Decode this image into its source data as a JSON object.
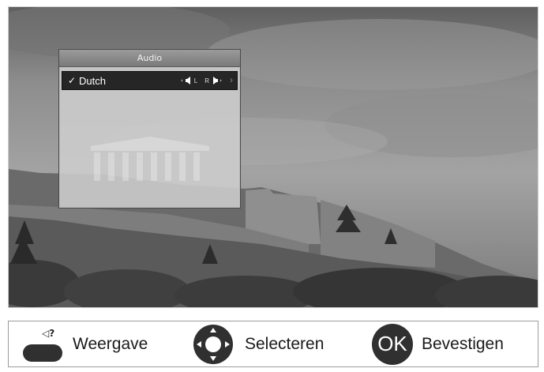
{
  "menu": {
    "title": "Audio",
    "selected_item": {
      "check": "✓",
      "language": "Dutch",
      "left_label": "L",
      "right_label": "R",
      "chevron": "›"
    }
  },
  "hints": {
    "view": {
      "icon_text": "◁?",
      "label": "Weergave"
    },
    "select": {
      "label": "Selecteren"
    },
    "confirm": {
      "button": "OK",
      "label": "Bevestigen"
    }
  },
  "colors": {
    "menu_title_bar": "#8a8a8a",
    "selected_row": "#262626",
    "button_dark": "#303030"
  },
  "icons": [
    "audio-question-icon",
    "dpad-icon",
    "speaker-left-icon",
    "speaker-right-icon",
    "checkmark-icon"
  ]
}
